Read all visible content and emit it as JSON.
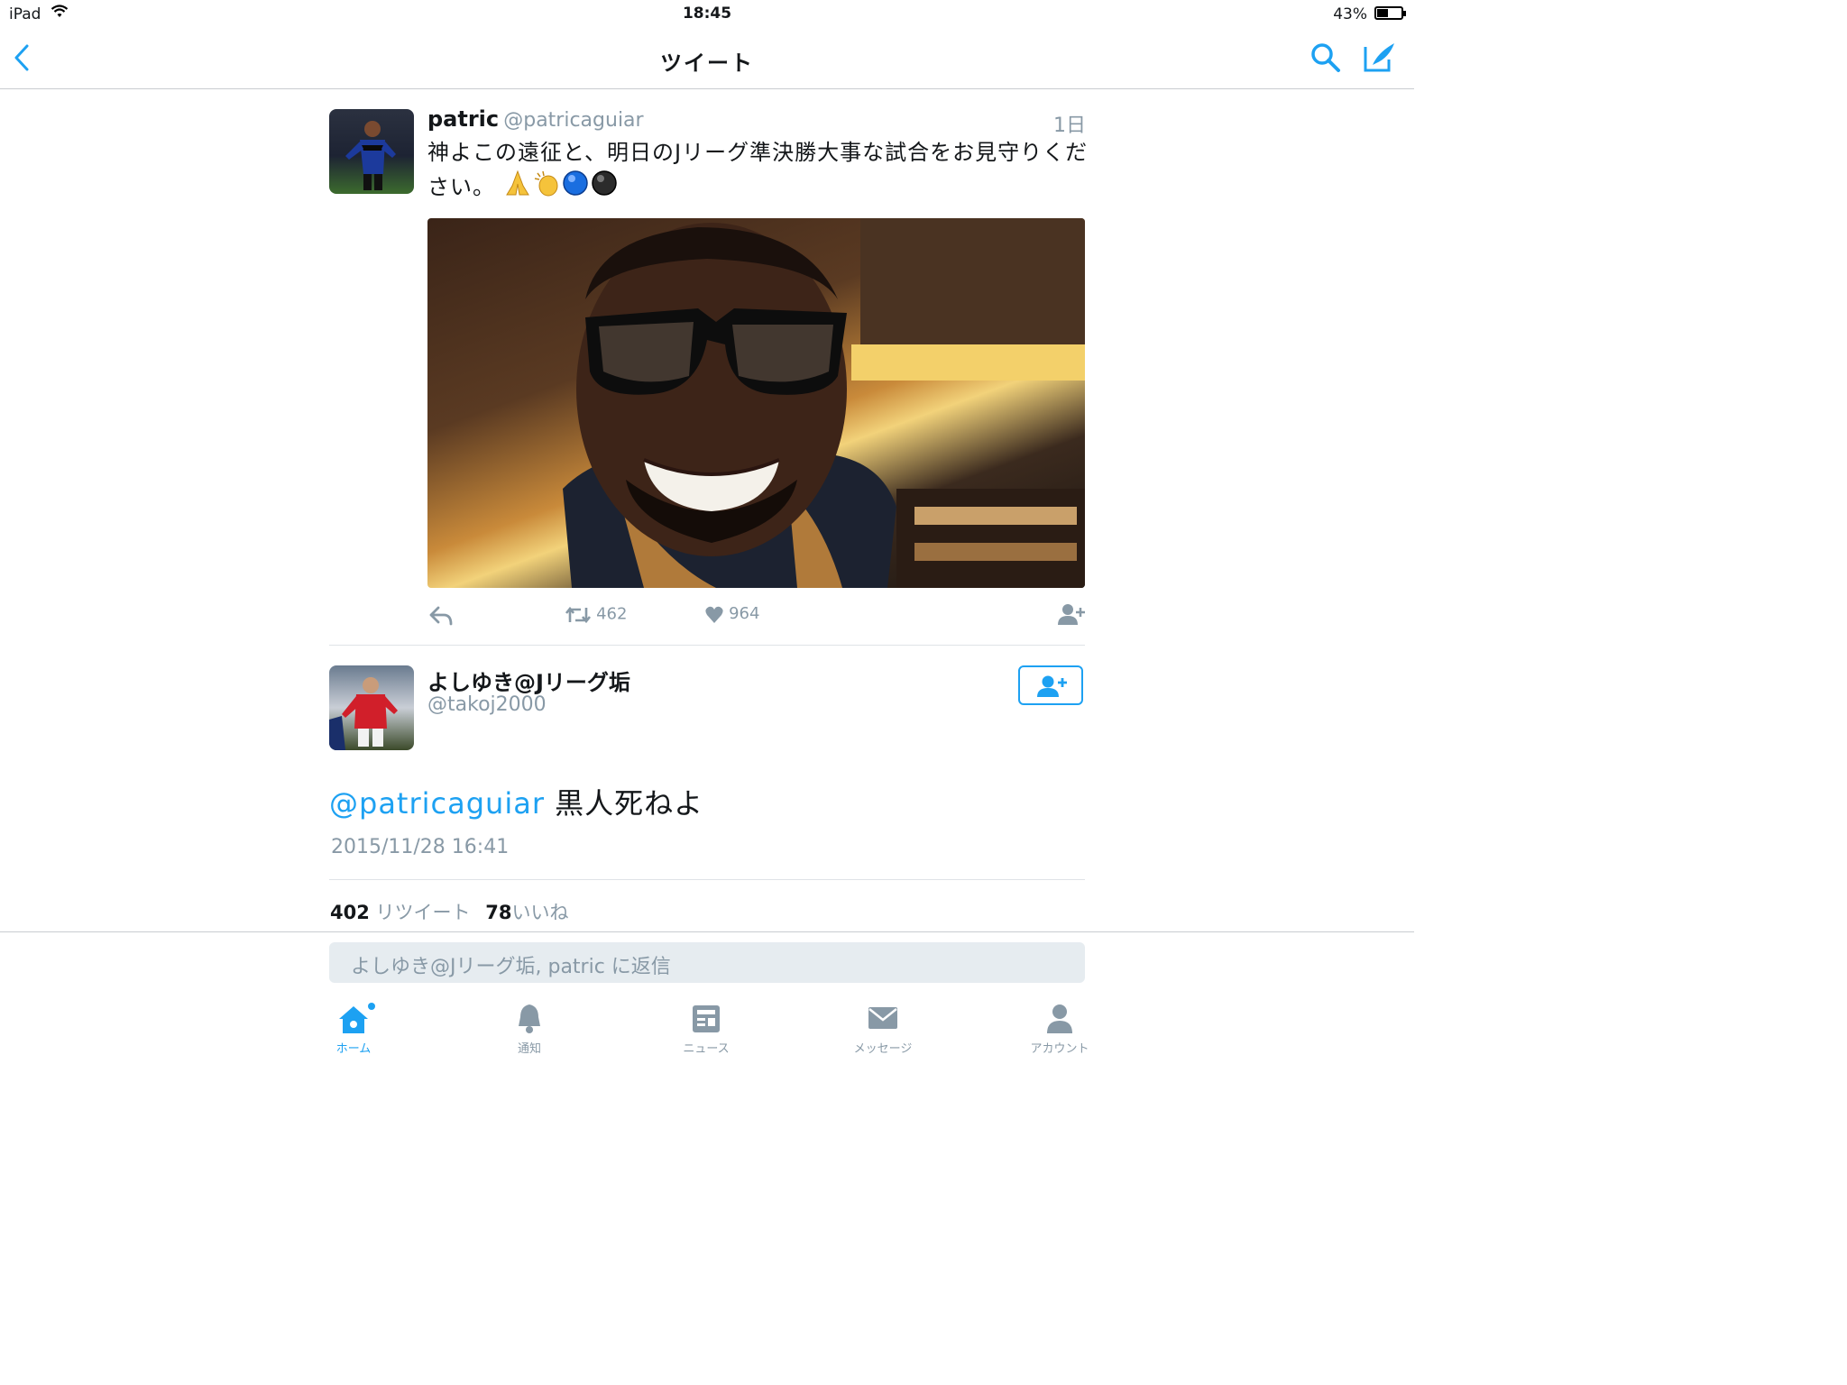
{
  "status_bar": {
    "carrier": "iPad",
    "time": "18:45",
    "battery": "43%",
    "battery_level": 0.43
  },
  "nav": {
    "title": "ツイート"
  },
  "quoted_tweet": {
    "user_name": "patric",
    "handle": "@patricaguiar",
    "age": "1日",
    "text": "神よこの遠征と、明日のJリーグ準決勝大事な試合をお見守りください。",
    "emojis": [
      "folded-hands-icon",
      "clapping-hands-icon",
      "blue-circle-icon",
      "black-circle-icon"
    ],
    "retweets": "462",
    "likes": "964"
  },
  "reply": {
    "user_name": "よしゆき@Jリーグ垢",
    "handle": "@takoj2000",
    "mention": "@patricaguiar",
    "text": " 黒人死ねよ",
    "timestamp": "2015/11/28 16:41",
    "retweet_count": "402",
    "retweet_label": "リツイート",
    "like_count": "78",
    "like_label": "いいね"
  },
  "reply_box": {
    "placeholder": "よしゆき@Jリーグ垢, patric に返信"
  },
  "tab_bar": {
    "items": [
      {
        "label": "ホーム",
        "icon": "home-icon",
        "active": true
      },
      {
        "label": "通知",
        "icon": "bell-icon"
      },
      {
        "label": "ニュース",
        "icon": "news-icon"
      },
      {
        "label": "メッセージ",
        "icon": "envelope-icon"
      },
      {
        "label": "アカウント",
        "icon": "person-icon"
      }
    ]
  },
  "colors": {
    "accent": "#1da1f2",
    "muted": "#8899a6",
    "text": "#14171a",
    "divider": "#dfe3e7"
  }
}
